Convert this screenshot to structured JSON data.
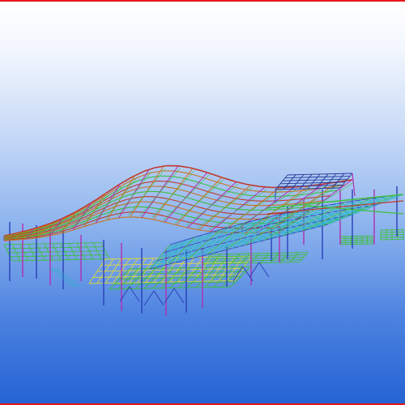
{
  "scene": {
    "kind": "3D structural steel model viewport",
    "frame_color": "#e8151b",
    "background_top": "#ffffff",
    "background_bottom": "#2563d4",
    "member_colors": {
      "beam_orange": "#c8741c",
      "beam_red": "#c0392b",
      "beam_green": "#3fbf3f",
      "beam_yellow": "#e0d83a",
      "column_magenta": "#b02fb0",
      "brace_blue": "#2a3fb8",
      "purlin_cyan": "#2bb5c8",
      "roof_navy": "#223a9a"
    }
  }
}
